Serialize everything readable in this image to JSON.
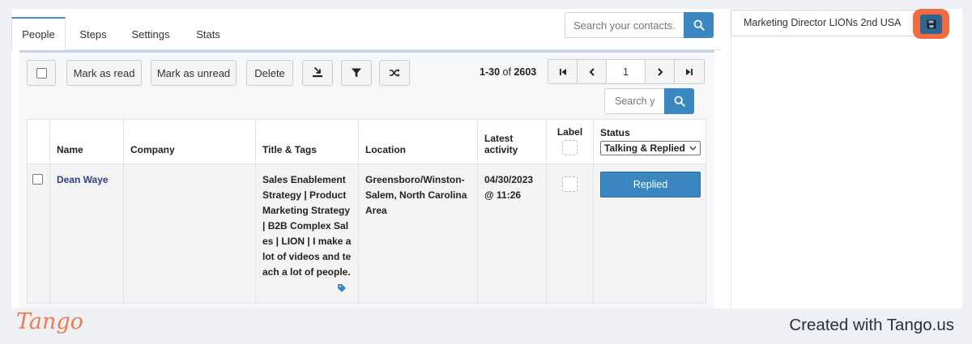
{
  "tabs": [
    {
      "label": "People",
      "active": true
    },
    {
      "label": "Steps",
      "active": false
    },
    {
      "label": "Settings",
      "active": false
    },
    {
      "label": "Stats",
      "active": false
    }
  ],
  "top_search": {
    "placeholder": "Search your contacts...",
    "icon": "search-icon"
  },
  "campaign": {
    "name": "Marketing Director LIONs 2nd USA",
    "save_icon": "floppy-disk-icon"
  },
  "toolbar": {
    "mark_read": "Mark as read",
    "mark_unread": "Mark as unread",
    "delete": "Delete",
    "export_icon": "export-icon",
    "filter_icon": "filter-icon",
    "shuffle_icon": "shuffle-icon"
  },
  "pagination": {
    "range": "1-30",
    "of": "of",
    "total": "2603",
    "page": "1"
  },
  "list_search": {
    "placeholder": "Search yo"
  },
  "table": {
    "headers": {
      "name": "Name",
      "company": "Company",
      "title": "Title & Tags",
      "location": "Location",
      "latest_activity": "Latest activity",
      "label": "Label",
      "status": "Status"
    },
    "status_filter": "Talking & Replied",
    "rows": [
      {
        "name": "Dean Waye",
        "company": "",
        "title": "Sales Enablement Strategy | Product Marketing Strategy | B2B Complex Sales | LION | I make a lot of videos and teach a lot of people.",
        "location": "Greensboro/Winston-Salem, North Carolina Area",
        "latest_activity": "04/30/2023 @ 11:26",
        "status": "Replied"
      }
    ]
  },
  "footer": {
    "brand": "Tango",
    "created": "Created with Tango.us"
  },
  "colors": {
    "accent": "#3a87c2",
    "highlight": "#f26a3f",
    "brand": "#ef7b4a"
  }
}
